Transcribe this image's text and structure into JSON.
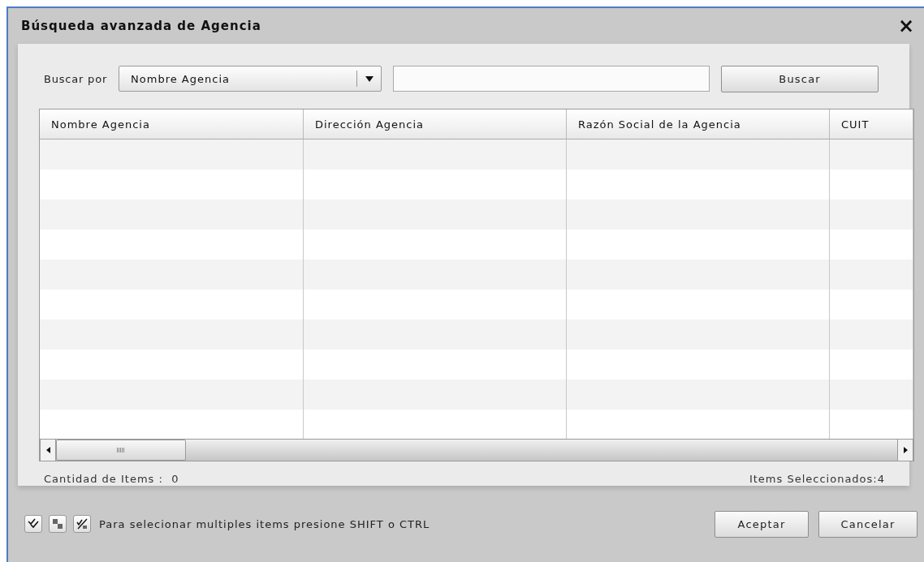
{
  "dialog": {
    "title": "Búsqueda avanzada de Agencia",
    "close": "×"
  },
  "search": {
    "label": "Buscar por",
    "field_select": "Nombre Agencia",
    "button": "Buscar"
  },
  "table": {
    "columns": [
      "Nombre Agencia",
      "Dirección Agencia",
      "Razón Social de la Agencia",
      "CUIT"
    ]
  },
  "summary": {
    "count_label": "Cantidad de Items :",
    "count": "0",
    "selected": "Items Seleccionados:4"
  },
  "footer": {
    "hint": "Para selecionar multiples items presione SHIFT o CTRL",
    "buttons": [
      "Aceptar",
      "Cancelar"
    ]
  }
}
